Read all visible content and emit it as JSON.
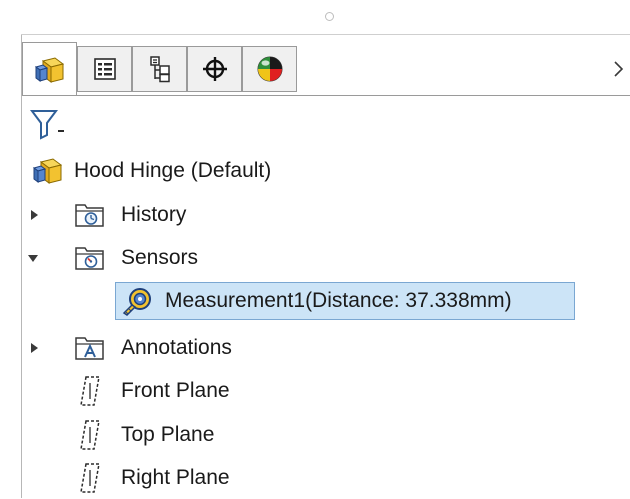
{
  "panel": {
    "tabs": [
      {
        "icon": "part-icon",
        "active": true
      },
      {
        "icon": "property-manager-icon",
        "active": false
      },
      {
        "icon": "configuration-manager-icon",
        "active": false
      },
      {
        "icon": "dimxpert-icon",
        "active": false
      },
      {
        "icon": "display-manager-icon",
        "active": false
      }
    ],
    "more_icon": "chevron-right-icon",
    "filter_icon": "filter-icon"
  },
  "tree": {
    "root": {
      "label": "Hood Hinge  (Default)",
      "icon": "part-icon"
    },
    "items": [
      {
        "label": "History",
        "icon": "history-folder-icon",
        "expander": "collapsed"
      },
      {
        "label": "Sensors",
        "icon": "sensors-folder-icon",
        "expander": "expanded"
      },
      {
        "label": "Measurement1(Distance: 37.338mm)",
        "icon": "measurement-sensor-icon",
        "selected": true
      },
      {
        "label": "Annotations",
        "icon": "annotations-folder-icon",
        "expander": "collapsed"
      },
      {
        "label": "Front Plane",
        "icon": "plane-icon"
      },
      {
        "label": "Top Plane",
        "icon": "plane-icon"
      },
      {
        "label": "Right Plane",
        "icon": "plane-icon"
      }
    ]
  },
  "colors": {
    "selection_fill": "#cce4f7",
    "selection_border": "#7aa7d2",
    "part_yellow": "#f2c230",
    "part_blue": "#3f6fb5"
  }
}
